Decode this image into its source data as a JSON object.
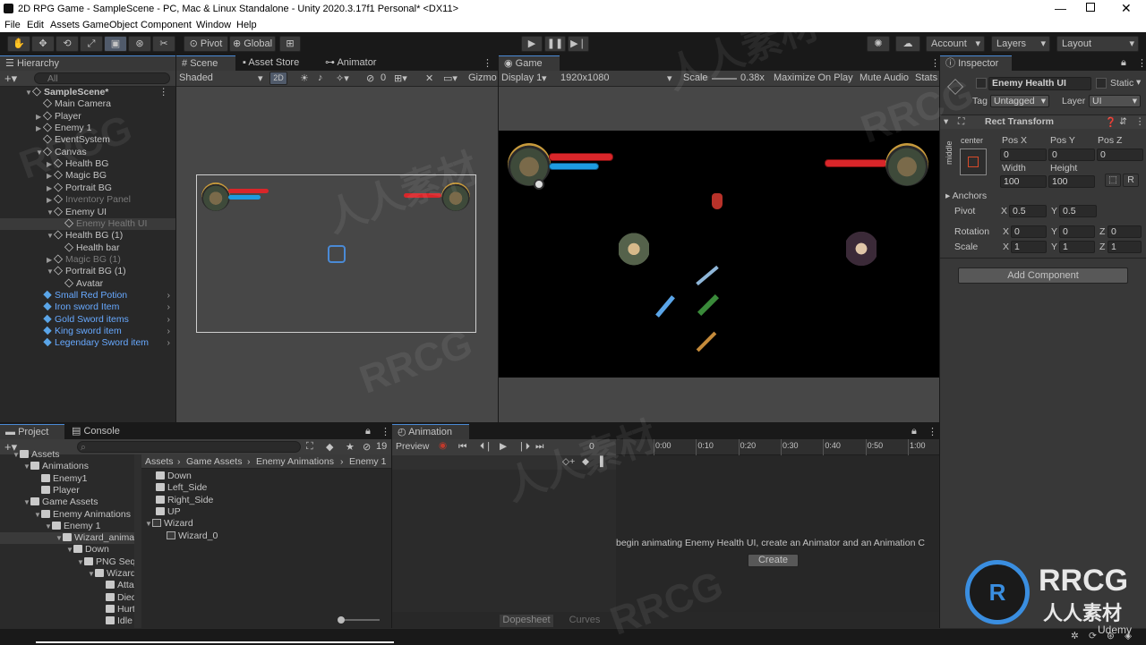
{
  "window": {
    "title": "2D RPG Game - SampleScene - PC, Mac & Linux Standalone - Unity 2020.3.17f1 Personal* <DX11>"
  },
  "menu": [
    "File",
    "Edit",
    "Assets",
    "GameObject",
    "Component",
    "Window",
    "Help"
  ],
  "toolbar": {
    "pivot": "Pivot",
    "global": "Global",
    "account": "Account",
    "layers": "Layers",
    "layout": "Layout"
  },
  "hierarchy": {
    "tab": "Hierarchy",
    "search_placeholder": "All",
    "items": [
      {
        "label": "SampleScene*",
        "indent": 0,
        "style": "scene"
      },
      {
        "label": "Main Camera",
        "indent": 1
      },
      {
        "label": "Player",
        "indent": 1
      },
      {
        "label": "Enemy 1",
        "indent": 1
      },
      {
        "label": "EventSystem",
        "indent": 1
      },
      {
        "label": "Canvas",
        "indent": 1
      },
      {
        "label": "Health BG",
        "indent": 2
      },
      {
        "label": "Magic BG",
        "indent": 2
      },
      {
        "label": "Portrait BG",
        "indent": 2
      },
      {
        "label": "Inventory Panel",
        "indent": 2,
        "style": "gray"
      },
      {
        "label": "Enemy UI",
        "indent": 2
      },
      {
        "label": "Enemy Health UI",
        "indent": 3,
        "style": "gray sel"
      },
      {
        "label": "Health BG (1)",
        "indent": 2
      },
      {
        "label": "Health bar",
        "indent": 3
      },
      {
        "label": "Magic BG (1)",
        "indent": 2,
        "style": "gray"
      },
      {
        "label": "Portrait BG (1)",
        "indent": 2
      },
      {
        "label": "Avatar",
        "indent": 3
      },
      {
        "label": "Small Red Potion",
        "indent": 1,
        "style": "blue"
      },
      {
        "label": "Iron sword Item",
        "indent": 1,
        "style": "blue"
      },
      {
        "label": "Gold Sword items",
        "indent": 1,
        "style": "blue"
      },
      {
        "label": "King sword item",
        "indent": 1,
        "style": "blue"
      },
      {
        "label": "Legendary Sword item",
        "indent": 1,
        "style": "blue"
      }
    ]
  },
  "scene": {
    "tabs": [
      "Scene",
      "Asset Store",
      "Animator"
    ],
    "shading": "Shaded",
    "mode2d": "2D",
    "gizmos": "Gizmo",
    "hidden_count": "0"
  },
  "game": {
    "tab": "Game",
    "display": "Display 1",
    "resolution": "1920x1080",
    "scale_label": "Scale",
    "scale_value": "0.38x",
    "maximize": "Maximize On Play",
    "mute": "Mute Audio",
    "stats": "Stats"
  },
  "inspector": {
    "tab": "Inspector",
    "object_name": "Enemy Health UI",
    "static_label": "Static",
    "tag_label": "Tag",
    "tag_value": "Untagged",
    "layer_label": "Layer",
    "layer_value": "UI",
    "component": "Rect Transform",
    "anchor_h": "center",
    "anchor_v": "middle",
    "pos": {
      "x_label": "Pos X",
      "y_label": "Pos Y",
      "z_label": "Pos Z",
      "x": "0",
      "y": "0",
      "z": "0"
    },
    "size": {
      "w_label": "Width",
      "h_label": "Height",
      "w": "100",
      "h": "100"
    },
    "anchors_label": "Anchors",
    "pivot": {
      "label": "Pivot",
      "x": "0.5",
      "y": "0.5"
    },
    "rotation": {
      "label": "Rotation",
      "x": "0",
      "y": "0",
      "z": "0"
    },
    "scale": {
      "label": "Scale",
      "x": "1",
      "y": "1",
      "z": "1"
    },
    "add_component": "Add Component"
  },
  "project": {
    "tabs": [
      "Project",
      "Console"
    ],
    "hidden_count": "19",
    "breadcrumb": [
      "Assets",
      "Game Assets",
      "Enemy Animations",
      "Enemy 1"
    ],
    "tree": [
      {
        "label": "Assets",
        "indent": 0
      },
      {
        "label": "Animations",
        "indent": 1
      },
      {
        "label": "Enemy1",
        "indent": 2
      },
      {
        "label": "Player",
        "indent": 2
      },
      {
        "label": "Game Assets",
        "indent": 1
      },
      {
        "label": "Enemy Animations",
        "indent": 2
      },
      {
        "label": "Enemy 1",
        "indent": 3
      },
      {
        "label": "Wizard_animati",
        "indent": 4,
        "sel": true
      },
      {
        "label": "Down",
        "indent": 5
      },
      {
        "label": "PNG Sequ",
        "indent": 6
      },
      {
        "label": "Wizard_",
        "indent": 7
      },
      {
        "label": "Attac",
        "indent": 8
      },
      {
        "label": "Died",
        "indent": 8
      },
      {
        "label": "Hurt",
        "indent": 8
      },
      {
        "label": "Idle E",
        "indent": 8
      }
    ],
    "files": [
      {
        "label": "Down",
        "type": "folder",
        "indent": 0
      },
      {
        "label": "Left_Side",
        "type": "folder",
        "indent": 0
      },
      {
        "label": "Right_Side",
        "type": "folder",
        "indent": 0
      },
      {
        "label": "UP",
        "type": "folder",
        "indent": 0
      },
      {
        "label": "Wizard",
        "type": "sprite",
        "indent": 0
      },
      {
        "label": "Wizard_0",
        "type": "sub",
        "indent": 1
      }
    ]
  },
  "animation": {
    "tab": "Animation",
    "preview": "Preview",
    "frame": "0",
    "ticks": [
      "0:00",
      "0:10",
      "0:20",
      "0:30",
      "0:40",
      "0:50",
      "1:00"
    ],
    "message": "begin animating Enemy Health UI, create an Animator and an Animation C",
    "create": "Create",
    "dopesheet": "Dopesheet",
    "curves": "Curves"
  },
  "watermark": {
    "brand": "RRCG",
    "sub": "人人素材",
    "udemy": "Udemy"
  },
  "colors": {
    "accent": "#4a8ad6",
    "prefab_blue": "#67a9ff",
    "health_red": "#d9262a",
    "mana_blue": "#1e9be0",
    "portrait_gold": "#c79a3c"
  }
}
